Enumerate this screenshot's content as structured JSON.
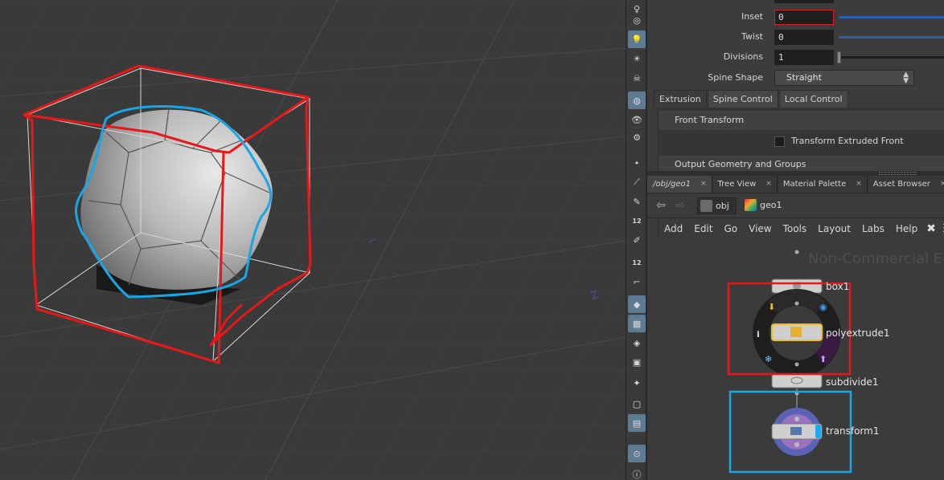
{
  "params": {
    "inset_label": "Inset",
    "inset_value": "0",
    "twist_label": "Twist",
    "twist_value": "0",
    "divisions_label": "Divisions",
    "divisions_value": "1",
    "spine_label": "Spine Shape",
    "spine_value": "Straight"
  },
  "param_tabs": [
    "Extrusion",
    "Spine Control",
    "Local Control"
  ],
  "folders": {
    "front_transform": "Front Transform",
    "transform_front_label": "Transform Extruded Front",
    "output_geometry": "Output Geometry and Groups"
  },
  "network_tabs": [
    "/obj/geo1",
    "Tree View",
    "Material Palette",
    "Asset Browser"
  ],
  "path": {
    "obj": "obj",
    "geo": "geo1"
  },
  "menu": [
    "Add",
    "Edit",
    "Go",
    "View",
    "Tools",
    "Layout",
    "Labs",
    "Help"
  ],
  "watermark": "Non-Commercial Ed",
  "nodes": {
    "box": "box1",
    "polyextrude": "polyextrude1",
    "subdivide": "subdivide1",
    "transform": "transform1"
  },
  "viewport_axis_label": "Z",
  "icons": [
    "wrench-icon",
    "info-icon",
    "back-arrow-icon",
    "forward-arrow-icon"
  ],
  "colors": {
    "annotation_red": "#e81818",
    "annotation_blue": "#19a6e6",
    "slider_blue": "#2d5fa8",
    "selected_node": "#f0c020"
  }
}
